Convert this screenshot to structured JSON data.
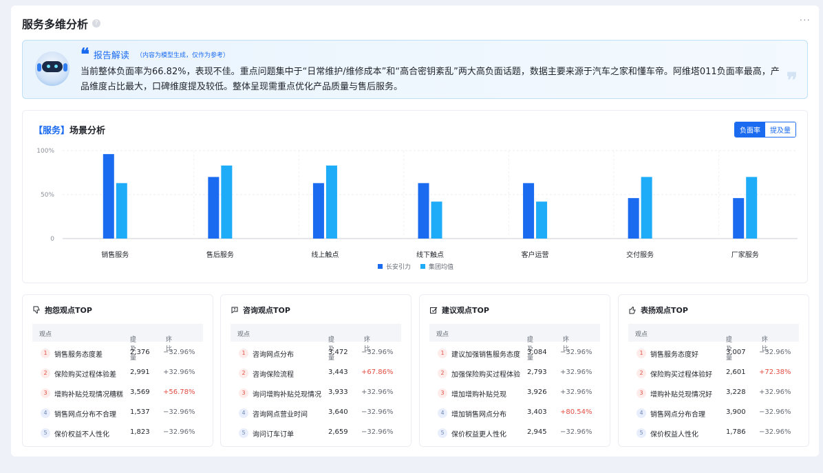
{
  "header": {
    "title": "服务多维分析",
    "help": "?",
    "more": "···"
  },
  "report": {
    "title": "报告解读",
    "note": "（内容为模型生成，仅作为参考）",
    "text": "当前整体负面率为66.82%，表现不佳。重点问题集中于“日常维护/维修成本”和“高合密钥紊乱”两大高负面话题，数据主要来源于汽车之家和懂车帝。阿维塔011负面率最高，产品维度占比最大，口碑维度提及较低。整体呈现需重点优化产品质量与售后服务。"
  },
  "scene": {
    "tag": "【服务】",
    "title": "场景分析",
    "toggle": {
      "active": "负面率",
      "inactive": "提及量"
    }
  },
  "chart_data": {
    "type": "bar",
    "categories": [
      "销售服务",
      "售后服务",
      "线上触点",
      "线下触点",
      "客户运营",
      "交付服务",
      "厂家服务"
    ],
    "series": [
      {
        "name": "长安引力",
        "color": "#1b6bf0",
        "values": [
          96,
          70,
          63,
          63,
          63,
          46,
          46
        ]
      },
      {
        "name": "集团均值",
        "color": "#1eabf7",
        "values": [
          63,
          83,
          83,
          42,
          42,
          70,
          70
        ]
      }
    ],
    "yticks": [
      "0",
      "50%",
      "100%"
    ],
    "ylim": [
      0,
      100
    ],
    "legend": "bottom-center",
    "grid": true
  },
  "panels": [
    {
      "icon": "thumb-down-icon",
      "title": "抱怨观点TOP",
      "cols": {
        "name": "观点",
        "count": "提及量",
        "ratio": "环比"
      },
      "rows": [
        {
          "rank": "1",
          "name": "销售服务态度差",
          "count": "2,376",
          "ratio": "−32.96%"
        },
        {
          "rank": "2",
          "name": "保险购买过程体验差",
          "count": "2,991",
          "ratio": "+32.96%"
        },
        {
          "rank": "3",
          "name": "增购补贴兑现情况糟糕",
          "count": "3,569",
          "ratio": "+56.78%"
        },
        {
          "rank": "4",
          "name": "销售网点分布不合理",
          "count": "1,537",
          "ratio": "−32.96%"
        },
        {
          "rank": "5",
          "name": "保价权益不人性化",
          "count": "1,823",
          "ratio": "−32.96%"
        }
      ]
    },
    {
      "icon": "question-chat-icon",
      "title": "咨询观点TOP",
      "cols": {
        "name": "观点",
        "count": "提及量",
        "ratio": "环比"
      },
      "rows": [
        {
          "rank": "1",
          "name": "咨询网点分布",
          "count": "3,472",
          "ratio": "−32.96%"
        },
        {
          "rank": "2",
          "name": "咨询保险流程",
          "count": "3,443",
          "ratio": "+67.86%"
        },
        {
          "rank": "3",
          "name": "询问增购补贴兑现情况",
          "count": "3,933",
          "ratio": "+32.96%"
        },
        {
          "rank": "4",
          "name": "咨询网点营业时间",
          "count": "3,640",
          "ratio": "−32.96%"
        },
        {
          "rank": "5",
          "name": "询问订车订单",
          "count": "2,659",
          "ratio": "−32.96%"
        }
      ]
    },
    {
      "icon": "suggestion-icon",
      "title": "建议观点TOP",
      "cols": {
        "name": "观点",
        "count": "提及量",
        "ratio": "环比"
      },
      "rows": [
        {
          "rank": "1",
          "name": "建议加强销售服务态度",
          "count": "3,084",
          "ratio": "−32.96%"
        },
        {
          "rank": "2",
          "name": "加强保险购买过程体验",
          "count": "2,793",
          "ratio": "+32.96%"
        },
        {
          "rank": "3",
          "name": "增加增购补贴兑现",
          "count": "3,926",
          "ratio": "+32.96%"
        },
        {
          "rank": "4",
          "name": "增加销售网点分布",
          "count": "3,403",
          "ratio": "+80.54%"
        },
        {
          "rank": "5",
          "name": "保价权益更人性化",
          "count": "2,945",
          "ratio": "−32.96%"
        }
      ]
    },
    {
      "icon": "thumb-up-icon",
      "title": "表扬观点TOP",
      "cols": {
        "name": "观点",
        "count": "提及量",
        "ratio": "环比"
      },
      "rows": [
        {
          "rank": "1",
          "name": "销售服务态度好",
          "count": "3,007",
          "ratio": "−32.96%"
        },
        {
          "rank": "2",
          "name": "保险购买过程体验好",
          "count": "2,601",
          "ratio": "+72.38%"
        },
        {
          "rank": "3",
          "name": "增购补贴兑现情况好",
          "count": "3,228",
          "ratio": "+32.96%"
        },
        {
          "rank": "4",
          "name": "销售网点分布合理",
          "count": "3,900",
          "ratio": "−32.96%"
        },
        {
          "rank": "5",
          "name": "保价权益人性化",
          "count": "1,786",
          "ratio": "−32.96%"
        }
      ]
    }
  ],
  "colors": {
    "accent": "#1b6bf0",
    "up": "#e34d43",
    "down": "#646a73"
  }
}
